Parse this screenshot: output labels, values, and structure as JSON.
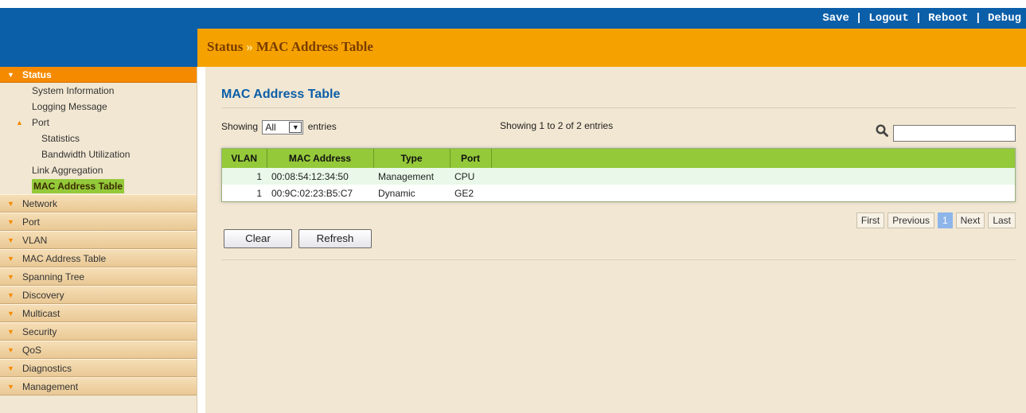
{
  "topbar": {
    "save": "Save",
    "logout": "Logout",
    "reboot": "Reboot",
    "debug": "Debug",
    "separator": "|"
  },
  "breadcrumb": {
    "section": "Status",
    "arrow": "»",
    "page": "MAC Address Table"
  },
  "sidebar": {
    "active_group": "Status",
    "status_children": {
      "system_information": "System Information",
      "logging_message": "Logging Message",
      "port": "Port",
      "statistics": "Statistics",
      "bandwidth_utilization": "Bandwidth Utilization",
      "link_aggregation": "Link Aggregation",
      "mac_address_table": "MAC Address Table"
    },
    "groups": [
      "Network",
      "Port",
      "VLAN",
      "MAC Address Table",
      "Spanning Tree",
      "Discovery",
      "Multicast",
      "Security",
      "QoS",
      "Diagnostics",
      "Management"
    ]
  },
  "main": {
    "heading": "MAC Address Table",
    "showing_prefix": "Showing",
    "entries_select_value": "All",
    "showing_suffix": "entries",
    "info": "Showing 1 to 2 of 2 entries",
    "table": {
      "headers": [
        "VLAN",
        "MAC Address",
        "Type",
        "Port"
      ],
      "rows": [
        [
          "1",
          "00:08:54:12:34:50",
          "Management",
          "CPU"
        ],
        [
          "1",
          "00:9C:02:23:B5:C7",
          "Dynamic",
          "GE2"
        ]
      ]
    },
    "pager": {
      "first": "First",
      "previous": "Previous",
      "current": "1",
      "next": "Next",
      "last": "Last"
    },
    "buttons": {
      "clear": "Clear",
      "refresh": "Refresh"
    }
  },
  "colors": {
    "topbar": "#0b5ea8",
    "titlebar": "#f5a200",
    "header_green": "#94c93a",
    "accent_orange": "#f58a00"
  }
}
